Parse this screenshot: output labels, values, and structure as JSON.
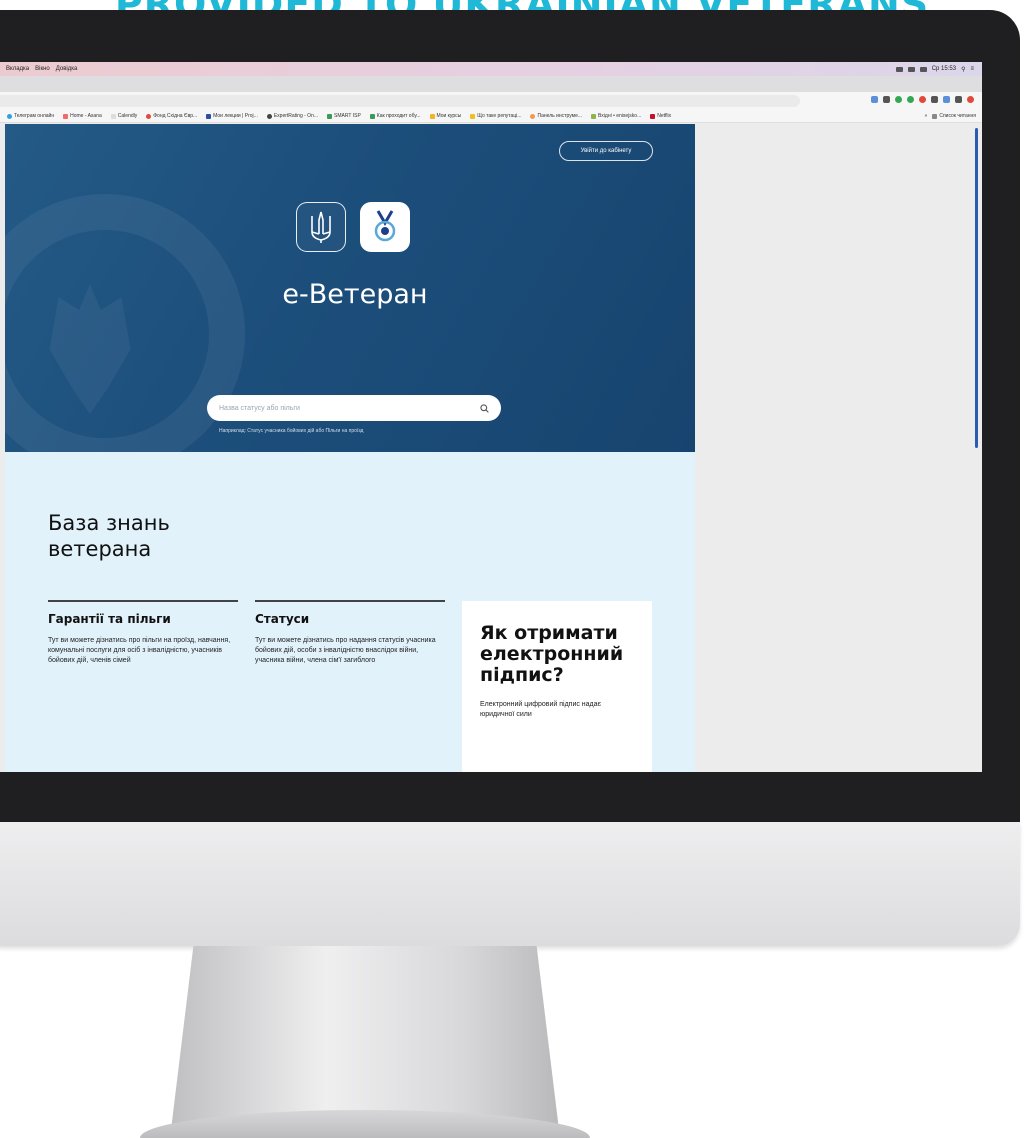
{
  "headline": "PROVIDED TO UKRAINIAN VETERANS",
  "menubar": {
    "items": [
      "Вкладка",
      "Вікно",
      "Довідка"
    ],
    "clock": "Ср 15:53"
  },
  "bookmarks": [
    "Телеграм онлайн",
    "Home - Asana",
    "Calendly",
    "Фонд Східна Євр...",
    "Мои лекции | Proj...",
    "ExpertRating - On...",
    "SMART ISP",
    "Как проходит обу...",
    "Мои курсы",
    "Що таке репутаці...",
    "Панель инструме...",
    "Вхідні • enisejsko...",
    "Netflix"
  ],
  "reading_list": "Список читання",
  "hero": {
    "login_button": "Увійти до кабінету",
    "title": "е-Ветеран",
    "search_placeholder": "Назва статусу або пільги",
    "search_hint": "Наприклад: Статус учасника бойових дій або Пільги на проїзд"
  },
  "knowledge": {
    "title": "База знань ветерана",
    "cards": [
      {
        "title": "Гарантії та пільги",
        "text": "Тут ви можете дізнатись про пільги на проїзд, навчання, комунальні послуги для осіб з інвалідністю, учасників бойових дій, членів сімей"
      },
      {
        "title": "Статуси",
        "text": "Тут ви можете дізнатись про надання статусів учасника бойових дій, особи з інвалідністю внаслідок війни, учасника війни, члена сім'ї загиблого"
      }
    ],
    "sign": {
      "title": "Як отримати електронний підпис?",
      "text": "Електронний цифровий підпис надає юридичної сили"
    }
  },
  "colors": {
    "headline": "#1fb8d6",
    "hero_bg": "#1d4f7c",
    "knowledge_bg": "#e1f2fb",
    "scrollbar": "#2b5cad"
  }
}
